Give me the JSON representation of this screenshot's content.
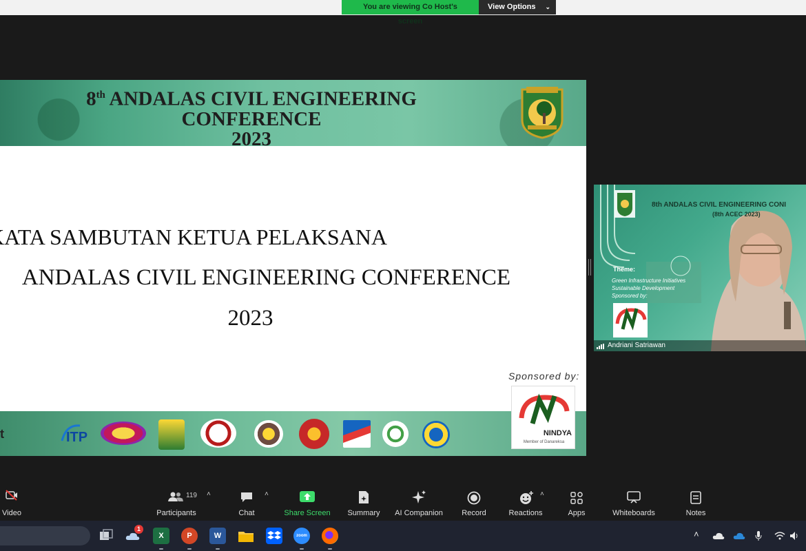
{
  "banner": {
    "viewing_text": "You are viewing Co Host's screen",
    "options_label": "View Options"
  },
  "slide": {
    "conf_title_line1_pre": "8",
    "conf_title_sup": "th",
    "conf_title_line1_post": " ANDALAS CIVIL ENGINEERING",
    "conf_title_line2": "CONFERENCE",
    "conf_title_line3": "2023",
    "body_line1": "KATA SAMBUTAN KETUA PELAKSANA",
    "body_line2": "ANDALAS CIVIL ENGINEERING CONFERENCE",
    "body_line3": "2023",
    "sponsored_label": "Sponsored by:",
    "sponsor_name": "NINDYA",
    "sponsor_tagline": "Member of Danareksa",
    "partner_logo_1": "ITP",
    "edge_text": "t"
  },
  "video": {
    "bg_title": "8th ANDALAS CIVIL ENGINEERING CONI",
    "bg_sub": "(8th ACEC 2023)",
    "theme_label": "Theme:",
    "theme_line1": "Green Infrastructure Initiatives",
    "theme_line2": "Sustainable Development",
    "sponsored_label": "Sponsored by:",
    "participant_name": "Andriani Satriawan"
  },
  "toolbar": {
    "video_label": "Video",
    "participants_label": "Participants",
    "participants_count": "119",
    "chat_label": "Chat",
    "share_label": "Share Screen",
    "summary_label": "Summary",
    "ai_label": "AI Companion",
    "record_label": "Record",
    "reactions_label": "Reactions",
    "apps_label": "Apps",
    "whiteboards_label": "Whiteboards",
    "notes_label": "Notes"
  },
  "taskbar": {
    "notification_badge": "1",
    "apps": [
      "task-view",
      "weather",
      "excel",
      "powerpoint",
      "word",
      "file-explorer",
      "dropbox",
      "zoom",
      "firefox"
    ]
  },
  "colors": {
    "share_green": "#3ddc6b",
    "banner_green": "#1fb94b",
    "slide_header_green": "#6fc0a0"
  }
}
